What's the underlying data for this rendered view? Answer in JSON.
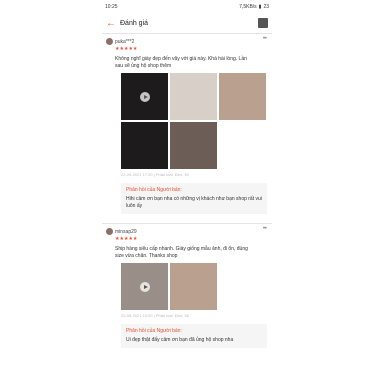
{
  "status": {
    "time": "10:25",
    "network": "7,5KB/s",
    "battery": "23"
  },
  "header": {
    "title": "Đánh giá"
  },
  "reviews": [
    {
      "user": "puka***2",
      "stars": "★★★★★",
      "text": "Không nghĩ giày đẹp đến vậy với giá này. Khá hài lòng. Lần sau sẽ ủng hộ shop thêm",
      "meta": "22-09-2021 17:30 | Phân loại: Đen, 39",
      "seller_head": "Phản hồi của Người bán:",
      "seller_body": "Hihi cảm ơn bạn nha có những vị khách như bạn shop rất vui luôn ấy"
    },
    {
      "user": "minsap29",
      "stars": "★★★★★",
      "text": "Ship hàng siêu cấp nhanh. Giày giống mẫu ảnh, đi ổn, đúng size vừa chân. Thanks shop",
      "meta": "22-09-2021 10:00 | Phân loại: Đen, 38",
      "seller_head": "Phản hồi của Người bán:",
      "seller_body": "Ui đẹp thật đấy cảm ơn bạn đã ủng hộ shop nha"
    }
  ]
}
